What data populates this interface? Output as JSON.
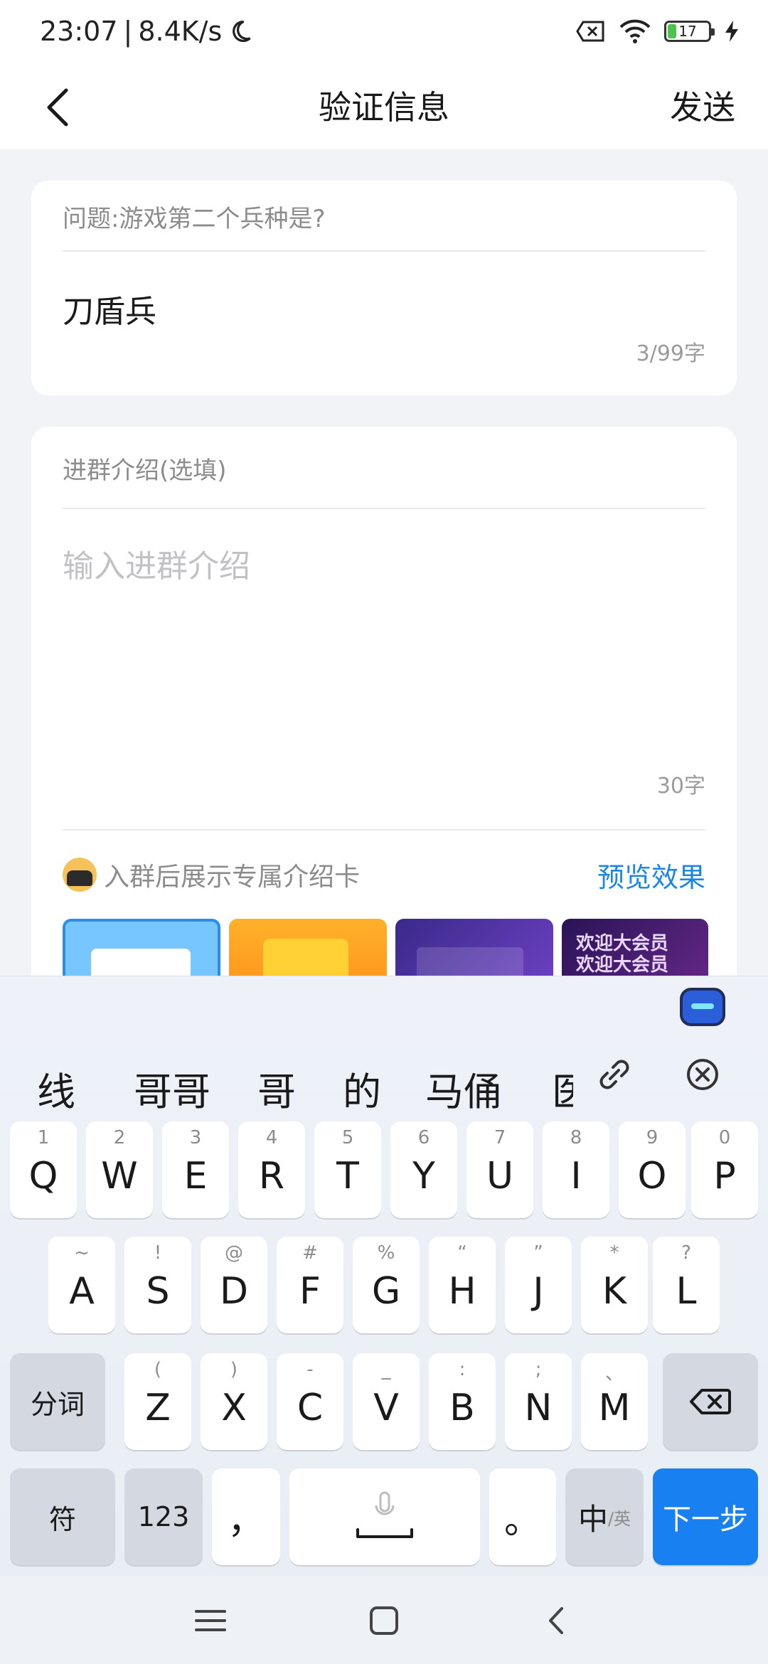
{
  "status_bar": {
    "time": "23:07",
    "separator": "|",
    "speed": "8.4K/s",
    "battery": "17"
  },
  "header": {
    "title": "验证信息",
    "send_label": "发送"
  },
  "question_card": {
    "question": "问题:游戏第二个兵种是?",
    "answer": "刀盾兵",
    "counter": "3/99字"
  },
  "intro_card": {
    "label": "进群介绍(选填)",
    "placeholder": "输入进群介绍",
    "counter": "30字",
    "card_promo": "入群后展示专属介绍卡",
    "preview_label": "预览效果",
    "thumb4_text_line1": "欢迎大会员",
    "thumb4_text_line2": "欢迎大会员"
  },
  "keyboard": {
    "candidates": [
      "线",
      "哥哥",
      "哥",
      "的",
      "马俑",
      "医"
    ],
    "row1": [
      {
        "key": "Q",
        "sub": "1"
      },
      {
        "key": "W",
        "sub": "2"
      },
      {
        "key": "E",
        "sub": "3"
      },
      {
        "key": "R",
        "sub": "4"
      },
      {
        "key": "T",
        "sub": "5"
      },
      {
        "key": "Y",
        "sub": "6"
      },
      {
        "key": "U",
        "sub": "7"
      },
      {
        "key": "I",
        "sub": "8"
      },
      {
        "key": "O",
        "sub": "9"
      },
      {
        "key": "P",
        "sub": "0"
      }
    ],
    "row2": [
      {
        "key": "A",
        "sub": "~"
      },
      {
        "key": "S",
        "sub": "!"
      },
      {
        "key": "D",
        "sub": "@"
      },
      {
        "key": "F",
        "sub": "#"
      },
      {
        "key": "G",
        "sub": "%"
      },
      {
        "key": "H",
        "sub": "“"
      },
      {
        "key": "J",
        "sub": "”"
      },
      {
        "key": "K",
        "sub": "*"
      },
      {
        "key": "L",
        "sub": "?"
      }
    ],
    "row3": [
      {
        "key": "Z",
        "sub": "("
      },
      {
        "key": "X",
        "sub": ")"
      },
      {
        "key": "C",
        "sub": "-"
      },
      {
        "key": "V",
        "sub": "_"
      },
      {
        "key": "B",
        "sub": ":"
      },
      {
        "key": "N",
        "sub": ";"
      },
      {
        "key": "M",
        "sub": "、"
      }
    ],
    "split_label": "分词",
    "symbols_label": "符",
    "numbers_label": "123",
    "comma_label": "，",
    "period_label": "。",
    "lang_label_main": "中",
    "lang_label_sub": "/英",
    "next_label": "下一步"
  },
  "colors": {
    "accent": "#1880f0",
    "link": "#1a86e8"
  }
}
